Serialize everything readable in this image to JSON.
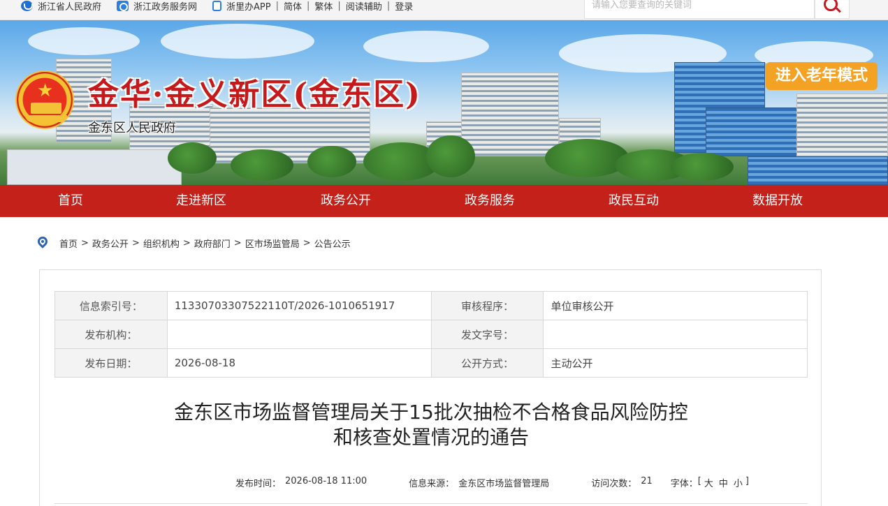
{
  "topbar": {
    "links": [
      {
        "label": "浙江省人民政府",
        "icon": "government-icon"
      },
      {
        "label": "浙江政务服务网",
        "icon": "service-icon"
      },
      {
        "label": "浙里办APP",
        "icon": "mobile-app-icon"
      }
    ],
    "text_links": [
      "简体",
      "繁体",
      "阅读辅助",
      "登录"
    ],
    "search_placeholder": "请输入您要查询的关键词",
    "search_icon": "search-icon"
  },
  "banner": {
    "brand": "金华·金义新区(金东区)",
    "subtitle": "金东区人民政府",
    "elder_mode": "进入老年模式"
  },
  "nav": [
    "首页",
    "走进新区",
    "政务公开",
    "政务服务",
    "政民互动",
    "数据开放"
  ],
  "breadcrumb": [
    "首页",
    "政务公开",
    "组织机构",
    "政府部门",
    "区市场监管局",
    "公告公示"
  ],
  "meta": {
    "index_label": "信息索引号：",
    "index_value": "11330703307522110T/2026-1010651917",
    "review_label": "审核程序：",
    "review_value": "单位审核公开",
    "org_label": "发布机构：",
    "org_value": "",
    "docno_label": "发文字号：",
    "docno_value": "",
    "date_label": "发布日期：",
    "date_value": "2026-08-18",
    "mode_label": "公开方式：",
    "mode_value": "主动公开"
  },
  "article": {
    "title_line1": "金东区市场监督管理局关于15批次抽检不合格食品风险防控",
    "title_line2": "和核查处置情况的通告",
    "time_label": "发布时间：",
    "time_value": "2026-08-18 11:00",
    "source_label": "信息来源：",
    "source_value": "金东区市场监督管理局",
    "visits_label": "访问次数：",
    "visits_value": "21",
    "font_label": "字体：",
    "font_open": "[",
    "font_large": "大",
    "font_medium": "中",
    "font_small": "小",
    "font_close": "]"
  },
  "colors": {
    "nav_red": "#c5211b",
    "elder_orange": "#f4a224",
    "brand_red": "#c5191c"
  }
}
